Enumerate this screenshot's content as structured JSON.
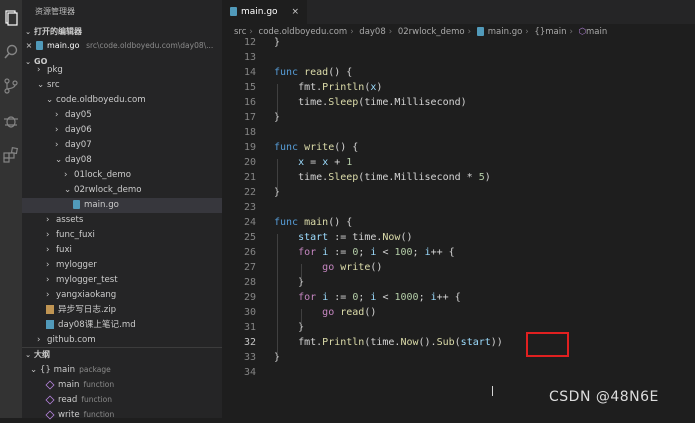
{
  "sidebar": {
    "title": "资源管理器",
    "open_editors_header": "打开的编辑器",
    "open_file_name": "main.go",
    "open_file_path": "src\\code.oldboyedu.com\\day08\\...",
    "workspace_header": "GO",
    "outline_header": "大纲",
    "tree": [
      {
        "label": "pkg",
        "chev": "›"
      },
      {
        "label": "src",
        "chev": "⌄"
      },
      {
        "label": "code.oldboyedu.com",
        "chev": "⌄"
      },
      {
        "label": "day05",
        "chev": "›"
      },
      {
        "label": "day06",
        "chev": "›"
      },
      {
        "label": "day07",
        "chev": "›"
      },
      {
        "label": "day08",
        "chev": "⌄"
      },
      {
        "label": "01lock_demo",
        "chev": "›"
      },
      {
        "label": "02rwlock_demo",
        "chev": "⌄"
      },
      {
        "label": "main.go"
      },
      {
        "label": "assets",
        "chev": "›"
      },
      {
        "label": "func_fuxi",
        "chev": "›"
      },
      {
        "label": "fuxi",
        "chev": "›"
      },
      {
        "label": "mylogger",
        "chev": "›"
      },
      {
        "label": "mylogger_test",
        "chev": "›"
      },
      {
        "label": "yangxiaokang",
        "chev": "›"
      },
      {
        "label": "异步写日志.zip"
      },
      {
        "label": "day08课上笔记.md"
      },
      {
        "label": "github.com",
        "chev": "›"
      }
    ],
    "outline": [
      {
        "label": "main",
        "kind": "package"
      },
      {
        "label": "main",
        "kind": "function"
      },
      {
        "label": "read",
        "kind": "function"
      },
      {
        "label": "write",
        "kind": "function"
      }
    ]
  },
  "tab": {
    "label": "main.go",
    "close": "×"
  },
  "breadcrumb": [
    "src",
    "code.oldboyedu.com",
    "day08",
    "02rwlock_demo",
    "main.go",
    "{}main",
    "main"
  ],
  "code_lines": [
    {
      "n": "12",
      "text": "}"
    },
    {
      "n": "13",
      "text": ""
    },
    {
      "n": "14",
      "text": "func read() {"
    },
    {
      "n": "15",
      "text": "    fmt.Println(x)"
    },
    {
      "n": "16",
      "text": "    time.Sleep(time.Millisecond)"
    },
    {
      "n": "17",
      "text": "}"
    },
    {
      "n": "18",
      "text": ""
    },
    {
      "n": "19",
      "text": "func write() {"
    },
    {
      "n": "20",
      "text": "    x = x + 1"
    },
    {
      "n": "21",
      "text": "    time.Sleep(time.Millisecond * 5)"
    },
    {
      "n": "22",
      "text": "}"
    },
    {
      "n": "23",
      "text": ""
    },
    {
      "n": "24",
      "text": "func main() {"
    },
    {
      "n": "25",
      "text": "    start := time.Now()"
    },
    {
      "n": "26",
      "text": "    for i := 0; i < 100; i++ {"
    },
    {
      "n": "27",
      "text": "        go write()"
    },
    {
      "n": "28",
      "text": "    }"
    },
    {
      "n": "29",
      "text": "    for i := 0; i < 1000; i++ {"
    },
    {
      "n": "30",
      "text": "        go read()"
    },
    {
      "n": "31",
      "text": "    }"
    },
    {
      "n": "32",
      "text": "    fmt.Println(time.Now().Sub(start))"
    },
    {
      "n": "33",
      "text": "}"
    },
    {
      "n": "34",
      "text": ""
    }
  ],
  "watermark": "CSDN @48N6E",
  "colors": {
    "accent": "#007acc",
    "highlight_box": "#e02020",
    "keyword": "#569cd6",
    "function": "#dcdcaa",
    "variable": "#9cdcfe",
    "number": "#b5cea8"
  }
}
